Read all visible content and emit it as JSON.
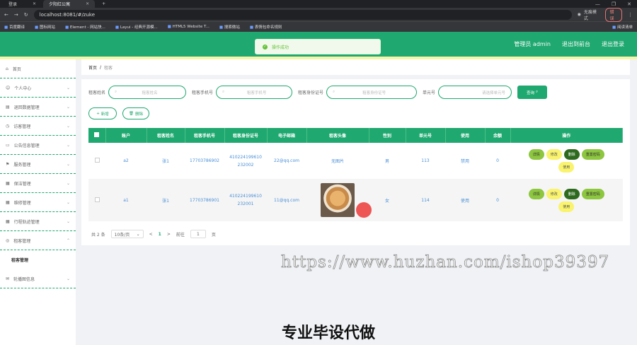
{
  "browser": {
    "tabs": [
      {
        "label": "登录"
      },
      {
        "label": "夕阳红公寓"
      }
    ],
    "new_tab": "+",
    "url": "localhost:8081/#/zuke",
    "incognito_label": "无痕模式",
    "error_label": "错误",
    "bookmarks": [
      "百度翻译",
      "图标网站",
      "Element - 网站快...",
      "Layui - 经典开源模...",
      "HTML5 Website T...",
      "搜索微站",
      "表情包命名规则"
    ],
    "bookmarks_right": "阅读清单"
  },
  "header": {
    "user": "管理员 admin",
    "back_to_front": "退出到前台",
    "logout": "退出登录"
  },
  "toast": {
    "message": "操作成功"
  },
  "sidebar": {
    "items": [
      {
        "label": "首页"
      },
      {
        "label": "个人中心"
      },
      {
        "label": "退回数据管理"
      },
      {
        "label": "访客管理"
      },
      {
        "label": "公告信息管理"
      },
      {
        "label": "服务管理"
      },
      {
        "label": "保洁管理"
      },
      {
        "label": "维修管理"
      },
      {
        "label": "行程轨迹管理"
      },
      {
        "label": "租客管理"
      },
      {
        "label": "租客管理"
      },
      {
        "label": "轮播图信息"
      }
    ]
  },
  "breadcrumb": {
    "home": "首页",
    "sep": "/",
    "current": "租客"
  },
  "filters": {
    "name_label": "租客姓名",
    "name_placeholder": "租客姓名",
    "phone_label": "租客手机号",
    "phone_placeholder": "租客手机号",
    "id_label": "租客身份证号",
    "id_placeholder": "租客身份证号",
    "unit_label": "单元号",
    "unit_placeholder": "请选择单元号",
    "search_button": "查询"
  },
  "toolbar": {
    "add": "新增",
    "delete": "删除"
  },
  "table": {
    "headers": [
      "账户",
      "租客姓名",
      "租客手机号",
      "租客身份证号",
      "电子邮箱",
      "租客头像",
      "性别",
      "单元号",
      "使用",
      "余额",
      "操作"
    ],
    "rows": [
      {
        "account": "a2",
        "name": "张1",
        "phone": "17703786902",
        "id_card": "410224199610232002",
        "email": "22@qq.com",
        "avatar": "无图片",
        "gender": "男",
        "unit": "113",
        "status": "禁用",
        "balance": "0"
      },
      {
        "account": "a1",
        "name": "张1",
        "phone": "17703786901",
        "id_card": "410224199610232001",
        "email": "11@qq.com",
        "avatar": "",
        "gender": "女",
        "unit": "114",
        "status": "使用",
        "balance": "0"
      }
    ],
    "row_actions": {
      "detail": "详情",
      "edit": "修改",
      "delete": "删除",
      "reset": "重置密码",
      "use": "使用"
    }
  },
  "pager": {
    "total": "共 2 条",
    "page_size": "10条/页",
    "prev": "<",
    "current": "1",
    "next": ">",
    "goto": "前往",
    "page_input": "1",
    "page_unit": "页"
  },
  "overlay": {
    "watermark": "https://www.huzhan.com/ishop39397",
    "bottom_text": "专业毕设代做"
  },
  "colors": {
    "brand": "#1fa86f",
    "yellow": "#f9f36d",
    "lightgreen": "#8dc63f",
    "darkgreen": "#2d6a1e"
  }
}
